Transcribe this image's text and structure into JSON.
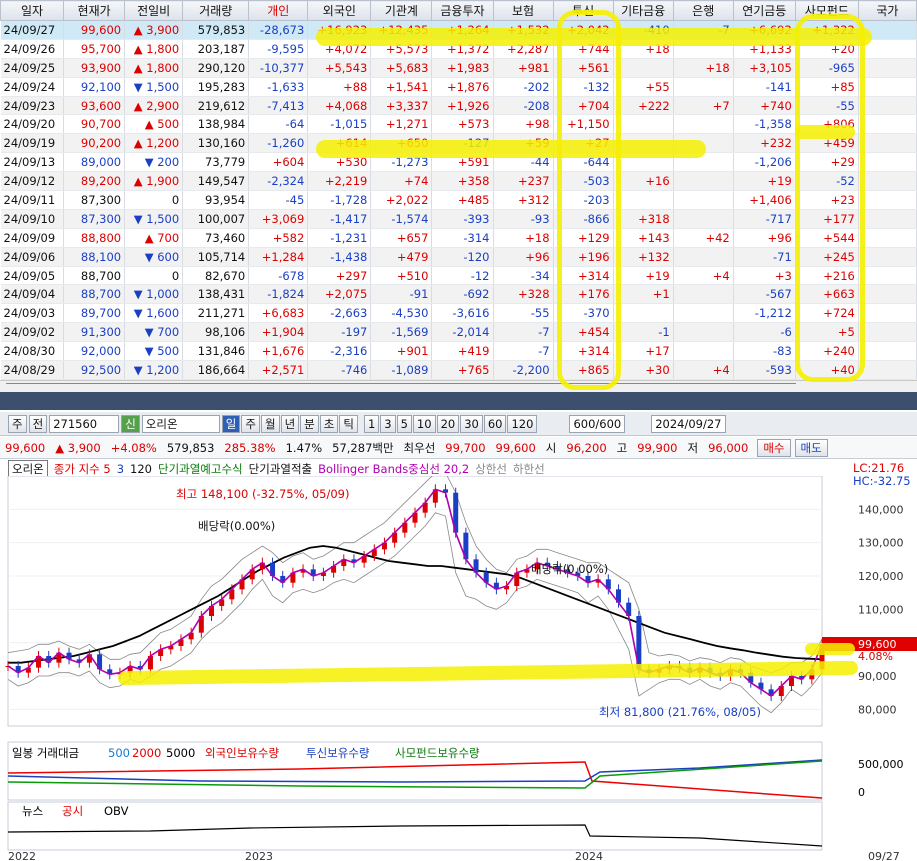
{
  "grid": {
    "headers": [
      "일자",
      "현재가",
      "전일비",
      "거래량",
      "개인",
      "외국인",
      "기관계",
      "금융투자",
      "보험",
      "투신",
      "기타금융",
      "은행",
      "연기금등",
      "사모펀드",
      "국가"
    ],
    "rows": [
      [
        "24/09/27",
        "99,600",
        "3,900",
        "579,853",
        "-28,673",
        "+16,923",
        "+12,435",
        "+1,264",
        "+1,532",
        "+2,042",
        "-410",
        "-7",
        "+6,692",
        "+1,322",
        ""
      ],
      [
        "24/09/26",
        "95,700",
        "1,800",
        "203,187",
        "-9,595",
        "+4,072",
        "+5,573",
        "+1,372",
        "+2,287",
        "+744",
        "+18",
        "",
        "+1,133",
        "+20",
        ""
      ],
      [
        "24/09/25",
        "93,900",
        "1,800",
        "290,120",
        "-10,377",
        "+5,543",
        "+5,683",
        "+1,983",
        "+981",
        "+561",
        "",
        "+18",
        "+3,105",
        "-965",
        ""
      ],
      [
        "24/09/24",
        "92,100",
        "1,500",
        "195,283",
        "-1,633",
        "+88",
        "+1,541",
        "+1,876",
        "-202",
        "-132",
        "+55",
        "",
        "-141",
        "+85",
        ""
      ],
      [
        "24/09/23",
        "93,600",
        "2,900",
        "219,612",
        "-7,413",
        "+4,068",
        "+3,337",
        "+1,926",
        "-208",
        "+704",
        "+222",
        "+7",
        "+740",
        "-55",
        ""
      ],
      [
        "24/09/20",
        "90,700",
        "500",
        "138,984",
        "-64",
        "-1,015",
        "+1,271",
        "+573",
        "+98",
        "+1,150",
        "",
        "",
        "-1,358",
        "+806",
        ""
      ],
      [
        "24/09/19",
        "90,200",
        "1,200",
        "130,160",
        "-1,260",
        "+614",
        "+650",
        "-127",
        "+59",
        "+27",
        "",
        "",
        "+232",
        "+459",
        ""
      ],
      [
        "24/09/13",
        "89,000",
        "200",
        "73,779",
        "+604",
        "+530",
        "-1,273",
        "+591",
        "-44",
        "-644",
        "",
        "",
        "-1,206",
        "+29",
        ""
      ],
      [
        "24/09/12",
        "89,200",
        "1,900",
        "149,547",
        "-2,324",
        "+2,219",
        "+74",
        "+358",
        "+237",
        "-503",
        "+16",
        "",
        "+19",
        "-52",
        ""
      ],
      [
        "24/09/11",
        "87,300",
        "0",
        "93,954",
        "-45",
        "-1,728",
        "+2,022",
        "+485",
        "+312",
        "-203",
        "",
        "",
        "+1,406",
        "+23",
        ""
      ],
      [
        "24/09/10",
        "87,300",
        "1,500",
        "100,007",
        "+3,069",
        "-1,417",
        "-1,574",
        "-393",
        "-93",
        "-866",
        "+318",
        "",
        "-717",
        "+177",
        ""
      ],
      [
        "24/09/09",
        "88,800",
        "700",
        "73,460",
        "+582",
        "-1,231",
        "+657",
        "-314",
        "+18",
        "+129",
        "+143",
        "+42",
        "+96",
        "+544",
        ""
      ],
      [
        "24/09/06",
        "88,100",
        "600",
        "105,714",
        "+1,284",
        "-1,438",
        "+479",
        "-120",
        "+96",
        "+196",
        "+132",
        "",
        "-71",
        "+245",
        ""
      ],
      [
        "24/09/05",
        "88,700",
        "0",
        "82,670",
        "-678",
        "+297",
        "+510",
        "-12",
        "-34",
        "+314",
        "+19",
        "+4",
        "+3",
        "+216",
        ""
      ],
      [
        "24/09/04",
        "88,700",
        "1,000",
        "138,431",
        "-1,824",
        "+2,075",
        "-91",
        "-692",
        "+328",
        "+176",
        "+1",
        "",
        "-567",
        "+663",
        ""
      ],
      [
        "24/09/03",
        "89,700",
        "1,600",
        "211,271",
        "+6,683",
        "-2,663",
        "-4,530",
        "-3,616",
        "-55",
        "-370",
        "",
        "",
        "-1,212",
        "+724",
        ""
      ],
      [
        "24/09/02",
        "91,300",
        "700",
        "98,106",
        "+1,904",
        "-197",
        "-1,569",
        "-2,014",
        "-7",
        "+454",
        "-1",
        "",
        "-6",
        "+5",
        ""
      ],
      [
        "24/08/30",
        "92,000",
        "500",
        "131,846",
        "+1,676",
        "-2,316",
        "+901",
        "+419",
        "-7",
        "+314",
        "+17",
        "",
        "-83",
        "+240",
        ""
      ],
      [
        "24/08/29",
        "92,500",
        "1,200",
        "186,664",
        "+2,571",
        "-746",
        "-1,089",
        "+765",
        "-2,200",
        "+865",
        "+30",
        "+4",
        "-593",
        "+40",
        ""
      ]
    ],
    "dirs": [
      "up",
      "up",
      "up",
      "dn",
      "up",
      "up",
      "up",
      "dn",
      "up",
      "nu",
      "dn",
      "up",
      "dn",
      "nu",
      "dn",
      "dn",
      "dn",
      "dn",
      "dn"
    ],
    "colors": {
      "up": "#d00000",
      "down": "#1a3fc4",
      "select": "#cfe9f6",
      "alt": "#f2f2f2"
    }
  },
  "toolbar": {
    "type_sel": "주",
    "prev_label": "전",
    "code": "271560",
    "sin_badge": "신",
    "stock_name": "오리온",
    "periods": [
      "일",
      "주",
      "월",
      "년",
      "분",
      "초",
      "틱"
    ],
    "minutes": [
      "1",
      "3",
      "5",
      "10",
      "20",
      "30",
      "60",
      "120"
    ],
    "count": "600/600",
    "date": "2024/09/27"
  },
  "quote": {
    "price": "99,600",
    "change": "3,900",
    "rate": "+4.08%",
    "volume": "579,853",
    "vol_ratio": "285.38%",
    "turnover": "1.47%",
    "amount": "57,287백만",
    "bid_label": "최우선",
    "ask": "99,700",
    "bid": "99,600",
    "open_label": "시",
    "open": "96,200",
    "high_label": "고",
    "high": "99,900",
    "low_label": "저",
    "low": "96,000",
    "buy_label": "매수",
    "sell_label": "매도"
  },
  "legend": {
    "name": "오리온",
    "ma_label": "종가 지수 5",
    "ma_3": "3",
    "ma_120": "120",
    "ind1": "단기과열예고수식",
    "ind2": "단기과열적출",
    "bb": "Bollinger Bands중심선 20,2",
    "upper": "상한선",
    "lower": "하한선",
    "lc": "LC:21.76",
    "hc": "HC:-32.75"
  },
  "chart_data": {
    "type": "line",
    "y_ticks": [
      "140,000",
      "130,000",
      "120,000",
      "110,000",
      "100,000",
      "90,000",
      "80,000"
    ],
    "ylim": [
      75000,
      150000
    ],
    "current_price": "99,600",
    "current_rate": "4.08%",
    "high_annotation": "최고 148,100 (-32.75%, 05/09)",
    "low_annotation": "최저 81,800 (21.76%, 08/05)",
    "dividend_label": "배당락(0.00%)",
    "x_labels": [
      "2022",
      "2023",
      "2024",
      "09/27"
    ],
    "close": [
      93000,
      91000,
      92500,
      96000,
      94000,
      97000,
      95000,
      94000,
      96500,
      92000,
      90500,
      91000,
      93000,
      92000,
      96000,
      98000,
      99000,
      101000,
      103000,
      108000,
      111000,
      113000,
      116000,
      119000,
      122000,
      124000,
      120000,
      118000,
      121000,
      122000,
      120000,
      121000,
      123000,
      125000,
      124000,
      126000,
      128000,
      130000,
      133000,
      136000,
      139000,
      142000,
      146000,
      145000,
      133000,
      125000,
      121000,
      118000,
      116000,
      117000,
      121000,
      122000,
      124000,
      123000,
      122000,
      121000,
      120000,
      118000,
      119000,
      116000,
      112000,
      108000,
      92000,
      91000,
      92000,
      93000,
      92500,
      91000,
      92500,
      91000,
      90000,
      92000,
      91000,
      88000,
      86000,
      84000,
      87000,
      90000,
      89000,
      92000,
      99600
    ],
    "ma120": [
      94000,
      94000,
      94500,
      95000,
      95500,
      96000,
      97000,
      98000,
      99000,
      100500,
      102000,
      104000,
      106000,
      108000,
      110000,
      112000,
      114000,
      116500,
      119000,
      121500,
      123500,
      125500,
      127000,
      128500,
      129000,
      128500,
      127500,
      126500,
      125500,
      124500,
      124000,
      123500,
      123000,
      123000,
      122500,
      122000,
      121500,
      121000,
      120500,
      119500,
      118000,
      116500,
      115000,
      113500,
      112000,
      110500,
      109000,
      107500,
      106000,
      104500,
      103000,
      102000,
      101000,
      100000,
      99000,
      98300,
      97700,
      97000,
      96400,
      95800,
      95400,
      95200,
      95000
    ],
    "bb_upper": [
      97000,
      97500,
      98000,
      99500,
      99500,
      100500,
      99000,
      98000,
      99500,
      97000,
      95000,
      95000,
      96500,
      97000,
      100000,
      103000,
      104000,
      106000,
      108000,
      113000,
      117000,
      119000,
      122000,
      125000,
      127000,
      129000,
      127000,
      124000,
      126000,
      127000,
      125000,
      126000,
      128000,
      130000,
      130000,
      132000,
      134000,
      136000,
      139000,
      142000,
      145000,
      148000,
      151000,
      151000,
      145000,
      136000,
      129000,
      125000,
      122000,
      121000,
      125000,
      126000,
      128000,
      128000,
      127000,
      126000,
      125000,
      124000,
      124000,
      122000,
      120000,
      118000,
      110000,
      97000,
      96000,
      96500,
      96000,
      94500,
      95500,
      95000,
      94000,
      95500,
      95000,
      93000,
      92000,
      91000,
      92000,
      94000,
      94000,
      96000,
      101000
    ],
    "bb_lower": [
      89000,
      87000,
      88000,
      90000,
      90000,
      91000,
      91000,
      90000,
      91500,
      88000,
      86500,
      87000,
      89000,
      88000,
      90000,
      92000,
      93000,
      95000,
      97000,
      101000,
      104000,
      106000,
      109000,
      112000,
      116000,
      119000,
      114000,
      112000,
      115000,
      116000,
      115000,
      116000,
      118000,
      119000,
      118000,
      120000,
      122000,
      124000,
      126000,
      129000,
      132000,
      135000,
      139000,
      138000,
      121000,
      114000,
      113000,
      111000,
      110000,
      112000,
      116000,
      117000,
      119000,
      118000,
      117000,
      116000,
      115000,
      112000,
      114000,
      110000,
      104000,
      98000,
      84000,
      86000,
      88000,
      89000,
      89000,
      87500,
      89000,
      87000,
      86000,
      88000,
      87000,
      84000,
      81000,
      79000,
      82000,
      86000,
      84000,
      87000,
      91000
    ]
  },
  "volume_legend": {
    "label": "일봉 거래대금",
    "v500": "500",
    "v2000": "2000",
    "v5000": "5000",
    "foreign": "외국인보유수량",
    "trust": "투신보유수량",
    "pef": "사모펀드보유수량",
    "tick_500k": "500,000",
    "tick_0": "0"
  },
  "obv_legend": {
    "news": "뉴스",
    "notice": "공시",
    "obv": "OBV"
  }
}
